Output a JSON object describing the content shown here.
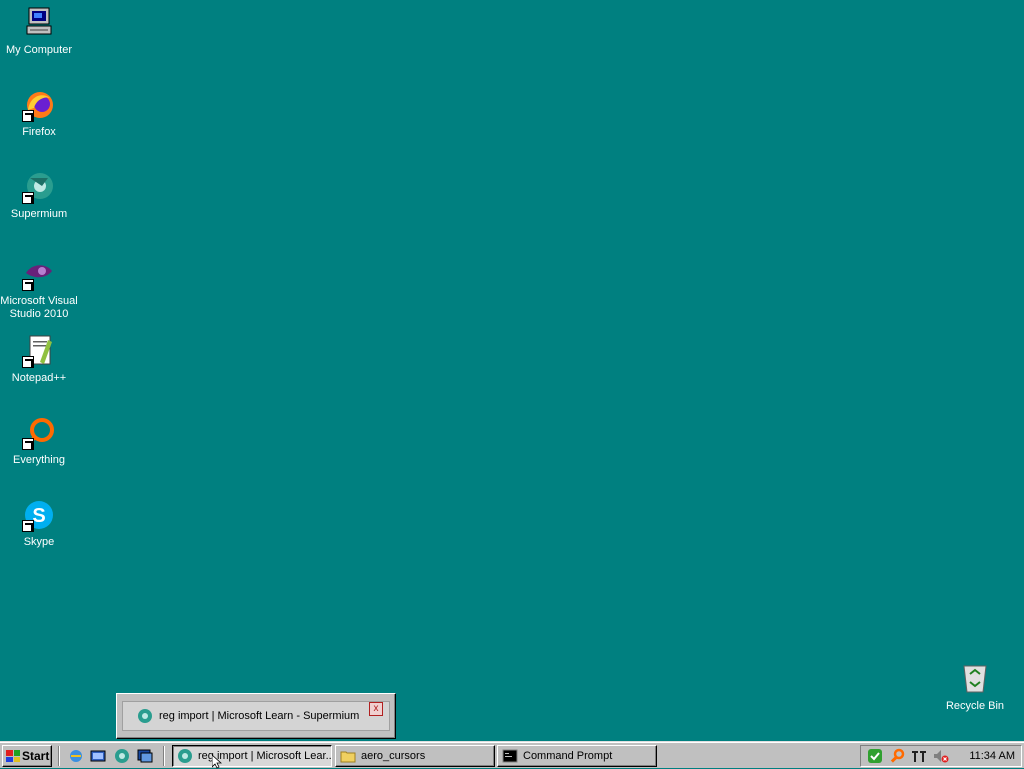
{
  "desktop": {
    "icons": [
      {
        "label": "My Computer",
        "icon": "my-computer-icon"
      },
      {
        "label": "Firefox",
        "icon": "firefox-icon"
      },
      {
        "label": "Supermium",
        "icon": "supermium-icon"
      },
      {
        "label": "Microsoft Visual Studio 2010",
        "icon": "visual-studio-icon"
      },
      {
        "label": "Notepad++",
        "icon": "notepad-plus-plus-icon"
      },
      {
        "label": "Everything",
        "icon": "everything-search-icon"
      },
      {
        "label": "Skype",
        "icon": "skype-icon"
      },
      {
        "label": "Recycle Bin",
        "icon": "recycle-bin-icon"
      }
    ],
    "background_color": "#008080"
  },
  "taskbar": {
    "start_label": "Start",
    "quick_launch": [
      "internet-explorer-icon",
      "show-desktop-icon",
      "supermium-icon",
      "window-switch-icon"
    ],
    "tasks": [
      {
        "label": "reg import | Microsoft Lear...",
        "icon": "supermium-icon",
        "active": true
      },
      {
        "label": "aero_cursors",
        "icon": "folder-icon",
        "active": false
      },
      {
        "label": "Command Prompt",
        "icon": "command-prompt-icon",
        "active": false
      }
    ],
    "tray_icons": [
      "security-check-icon",
      "search-magnifier-icon",
      "input-method-icon",
      "volume-muted-icon"
    ],
    "clock": "11:34 AM"
  },
  "popup": {
    "title": "reg import | Microsoft Learn - Supermium",
    "close_symbol": "x"
  }
}
